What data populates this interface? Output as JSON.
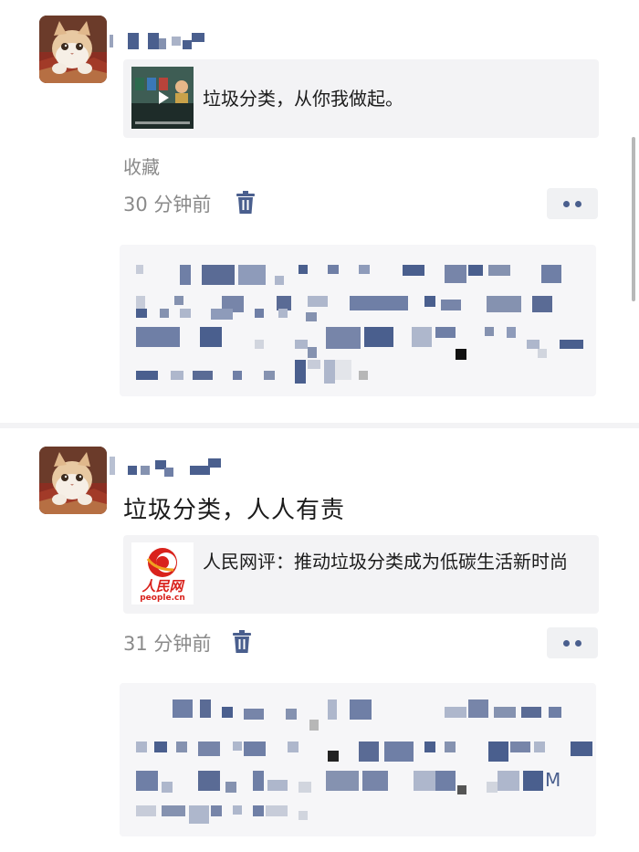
{
  "posts": [
    {
      "author_hidden": true,
      "link_title": "垃圾分类，从你我做起。",
      "source_label": "收藏",
      "time": "30 分钟前"
    },
    {
      "author_hidden": true,
      "text": "垃圾分类，人人有责",
      "link_title": "人民网评：推动垃圾分类成为低碳生活新时尚",
      "link_logo_text": "人民网",
      "link_logo_sub": "people.cn",
      "time": "31 分钟前"
    }
  ],
  "comment_box_2_trailing": "M",
  "colors": {
    "mosaic_blue": "#4a5f8e",
    "meta_gray": "#8a8a8a",
    "card_bg": "#f3f3f5"
  },
  "icons": [
    "trash-icon",
    "more-dots-icon",
    "play-icon",
    "people-daily-logo"
  ]
}
